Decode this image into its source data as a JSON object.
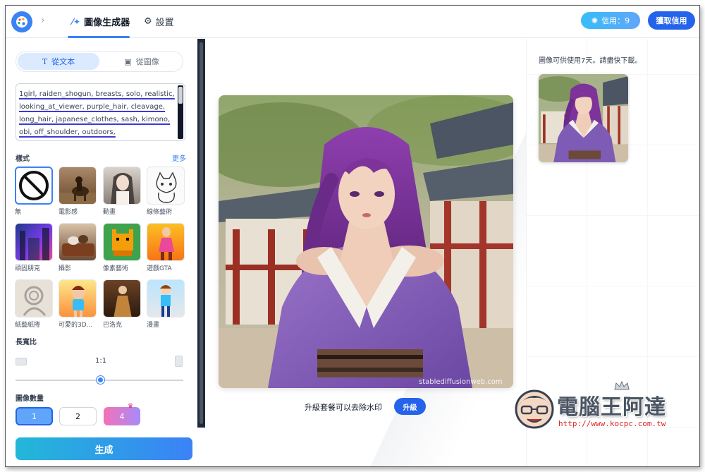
{
  "header": {
    "tab_generator": "圖像生成器",
    "tab_settings": "設置",
    "credits_label": "信用：9",
    "get_credits_button": "獲取信用"
  },
  "left_panel": {
    "mode_text": "從文本",
    "mode_image": "從圖像",
    "prompt": "1girl, raiden_shogun, breasts, solo, realistic, looking_at_viewer, purple_hair, cleavage, long_hair, japanese_clothes, sash, kimono, obi, off_shoulder, outdoors,",
    "style_heading": "樣式",
    "more_link": "更多",
    "styles": [
      {
        "label": "無"
      },
      {
        "label": "電影感"
      },
      {
        "label": "動畫"
      },
      {
        "label": "線條藝術"
      },
      {
        "label": "頑固朋克"
      },
      {
        "label": "攝影"
      },
      {
        "label": "像素藝術"
      },
      {
        "label": "遊戲GTA"
      },
      {
        "label": "紙藝紙捲"
      },
      {
        "label": "可愛的3D..."
      },
      {
        "label": "巴洛克"
      },
      {
        "label": "漫畫"
      }
    ],
    "aspect_heading": "長寬比",
    "aspect_value": "1:1",
    "aspect_slider_fraction": 0.5,
    "count_heading": "圖像數量",
    "count_options": [
      "1",
      "2",
      "4"
    ],
    "selected_count": "1",
    "generate_button": "生成"
  },
  "center": {
    "watermark": "stablediffusionweb.com",
    "upgrade_text": "升級套餐可以去除水印",
    "upgrade_button": "升級"
  },
  "right_panel": {
    "notice": "圖像可供使用7天。請盡快下載。"
  },
  "stamp": {
    "title": "電腦王阿達",
    "url": "http://www.kocpc.com.tw"
  },
  "colors": {
    "accent": "#3b82f6",
    "primary_button": "#2563eb",
    "generate_gradient_start": "#22b8d8",
    "hair_purple": "#7c3a9a",
    "kimono_purple": "#7e5bb5"
  }
}
